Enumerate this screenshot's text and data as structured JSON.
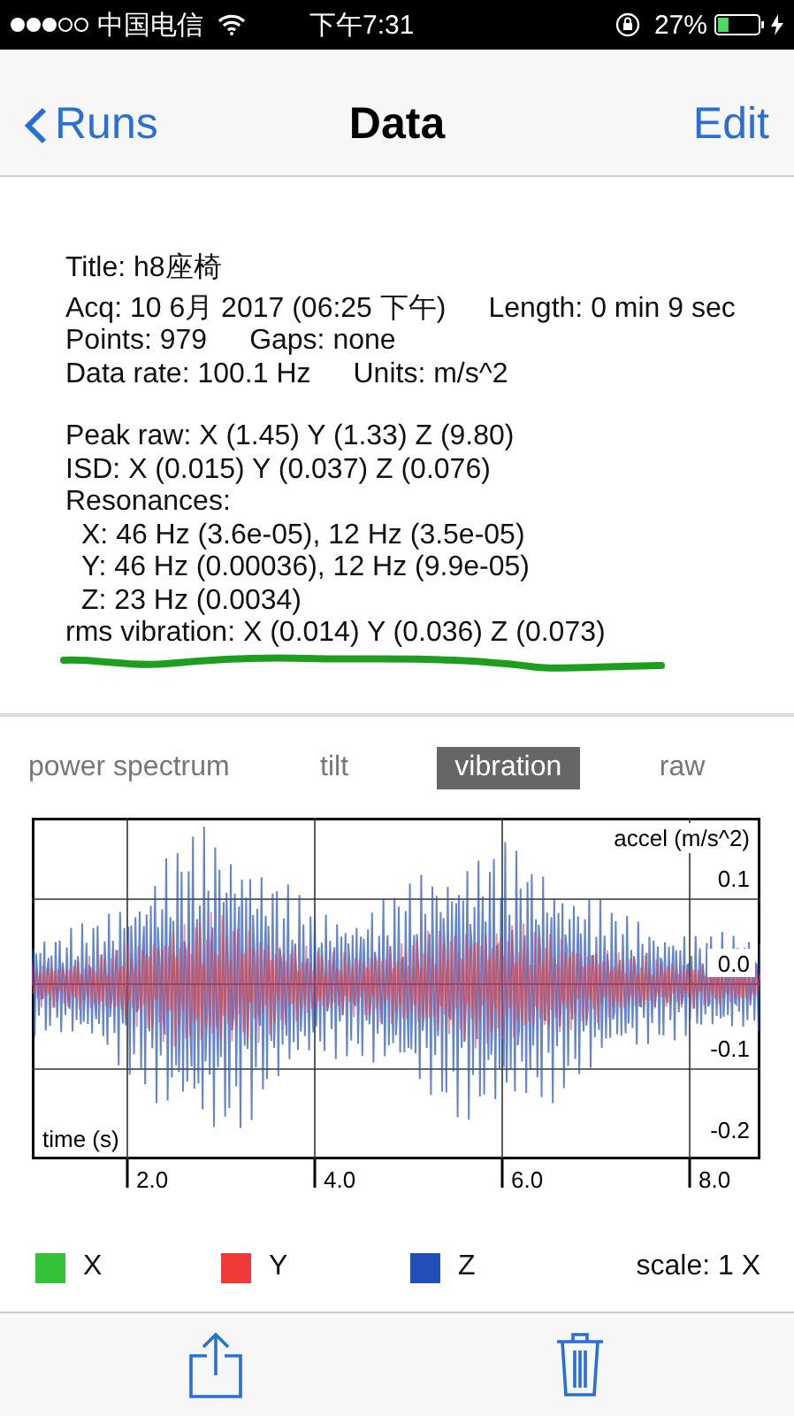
{
  "status_bar": {
    "signal_dots": [
      {
        "on": true
      },
      {
        "on": true
      },
      {
        "on": true
      },
      {
        "on": false
      },
      {
        "on": false
      }
    ],
    "carrier": "中国电信",
    "time": "下午7:31",
    "battery_text": "27%",
    "battery": {
      "level": 0.27
    }
  },
  "nav": {
    "back": "Runs",
    "title": "Data",
    "action": "Edit"
  },
  "info": {
    "groups": [
      [
        {
          "kind": "title",
          "parts": [
            "Title: h8座椅"
          ]
        },
        {
          "kind": "plain",
          "parts": [
            "Acq: 10 6月 2017 (06:25 下午)",
            "Length: 0 min 9 sec"
          ]
        },
        {
          "kind": "plain",
          "parts": [
            "Points: 979",
            "Gaps: none"
          ]
        },
        {
          "kind": "plain",
          "parts": [
            "Data rate: 100.1 Hz",
            "Units: m/s^2"
          ]
        }
      ],
      [
        {
          "kind": "plain",
          "parts": [
            "Peak raw: X (1.45) Y (1.33) Z (9.80)"
          ]
        },
        {
          "kind": "plain",
          "parts": [
            "ISD: X (0.015) Y (0.037) Z (0.076)"
          ]
        },
        {
          "kind": "plain",
          "parts": [
            "Resonances:"
          ]
        },
        {
          "kind": "sub",
          "parts": [
            "X:  46 Hz (3.6e-05), 12 Hz (3.5e-05)"
          ]
        },
        {
          "kind": "sub",
          "parts": [
            "Y:  46 Hz (0.00036), 12 Hz (9.9e-05)"
          ]
        },
        {
          "kind": "sub",
          "parts": [
            "Z:  23 Hz (0.0034)"
          ]
        },
        {
          "kind": "plain",
          "parts": [
            "rms vibration: X (0.014) Y (0.036) Z (0.073)"
          ]
        }
      ]
    ]
  },
  "tabs": [
    {
      "label": "power spectrum",
      "selected": false
    },
    {
      "label": "tilt",
      "selected": false
    },
    {
      "label": "vibration",
      "selected": true
    },
    {
      "label": "raw",
      "selected": false
    }
  ],
  "chart": {
    "ylabel": "accel (m/s^2)",
    "xlabel": "time (s)",
    "yticks": [
      "0.1",
      "0.0",
      "-0.1",
      "-0.2"
    ],
    "xticks": [
      "2.0",
      "4.0",
      "6.0",
      "8.0"
    ]
  },
  "legend": [
    {
      "label": "X",
      "color": "#34c238"
    },
    {
      "label": "Y",
      "color": "#f03a3a"
    },
    {
      "label": "Z",
      "color": "#2250b8"
    }
  ],
  "scale": "scale: 1 X"
}
